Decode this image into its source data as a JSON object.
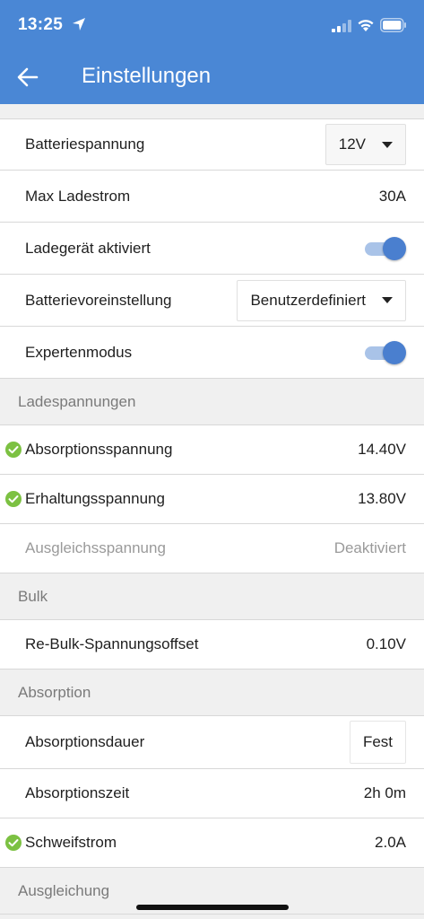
{
  "status_bar": {
    "time": "13:25"
  },
  "app_bar": {
    "title": "Einstellungen"
  },
  "general": {
    "battery_voltage": {
      "label": "Batteriespannung",
      "value": "12V"
    },
    "max_current": {
      "label": "Max Ladestrom",
      "value": "30A"
    },
    "charger_enabled": {
      "label": "Ladegerät aktiviert",
      "on": true
    },
    "battery_preset": {
      "label": "Batterievoreinstellung",
      "value": "Benutzerdefiniert"
    },
    "expert_mode": {
      "label": "Expertenmodus",
      "on": true
    }
  },
  "sections": {
    "charge_voltages": {
      "header": "Ladespannungen",
      "absorption": {
        "label": "Absorptionsspannung",
        "value": "14.40V"
      },
      "float": {
        "label": "Erhaltungsspannung",
        "value": "13.80V"
      },
      "equalization": {
        "label": "Ausgleichsspannung",
        "value": "Deaktiviert"
      }
    },
    "bulk": {
      "header": "Bulk",
      "rebulk_offset": {
        "label": "Re-Bulk-Spannungsoffset",
        "value": "0.10V"
      }
    },
    "absorption": {
      "header": "Absorption",
      "duration": {
        "label": "Absorptionsdauer",
        "value": "Fest"
      },
      "time": {
        "label": "Absorptionszeit",
        "value": "2h 0m"
      },
      "tail_current": {
        "label": "Schweifstrom",
        "value": "2.0A"
      }
    },
    "equalization": {
      "header": "Ausgleichung"
    }
  },
  "colors": {
    "primary": "#4a87d5",
    "check": "#7cc142",
    "toggle_thumb": "#4a7fcf",
    "toggle_track": "#a9c3e8"
  }
}
